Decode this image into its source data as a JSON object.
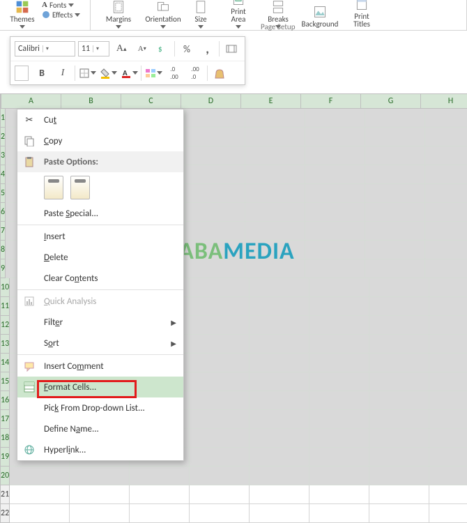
{
  "ribbon": {
    "themes": {
      "label": "Themes",
      "fonts": "Fonts",
      "effects": "Effects"
    },
    "page_setup": {
      "margins": "Margins",
      "orientation": "Orientation",
      "size": "Size",
      "print_area": "Print\nArea",
      "breaks": "Breaks",
      "background": "Background",
      "print_titles": "Print\nTitles",
      "group_label": "Page Setup"
    }
  },
  "mini": {
    "font_name": "Calibri",
    "font_size": "11",
    "bold": "B",
    "italic": "I"
  },
  "grid": {
    "columns": [
      "A",
      "B",
      "C",
      "D",
      "E",
      "F",
      "G",
      "H"
    ],
    "rows_selected": [
      1,
      2,
      3,
      4,
      5,
      6,
      7,
      8,
      9,
      10,
      11,
      12,
      13,
      14,
      15,
      16,
      17,
      18,
      19,
      20
    ],
    "rows_normal": [
      21,
      22
    ]
  },
  "context_menu": {
    "cut": "Cut",
    "copy": "Copy",
    "paste_options": "Paste Options:",
    "paste_special": "Paste Special...",
    "insert": "Insert",
    "delete": "Delete",
    "clear": "Clear Contents",
    "quick": "Quick Analysis",
    "filter": "Filter",
    "sort": "Sort",
    "comment": "Insert Comment",
    "format_cells": "Format Cells...",
    "pick": "Pick From Drop-down List...",
    "define": "Define Name...",
    "hyperlink": "Hyperlink..."
  },
  "watermark": {
    "a": "NESABA",
    "b": "MEDIA"
  }
}
